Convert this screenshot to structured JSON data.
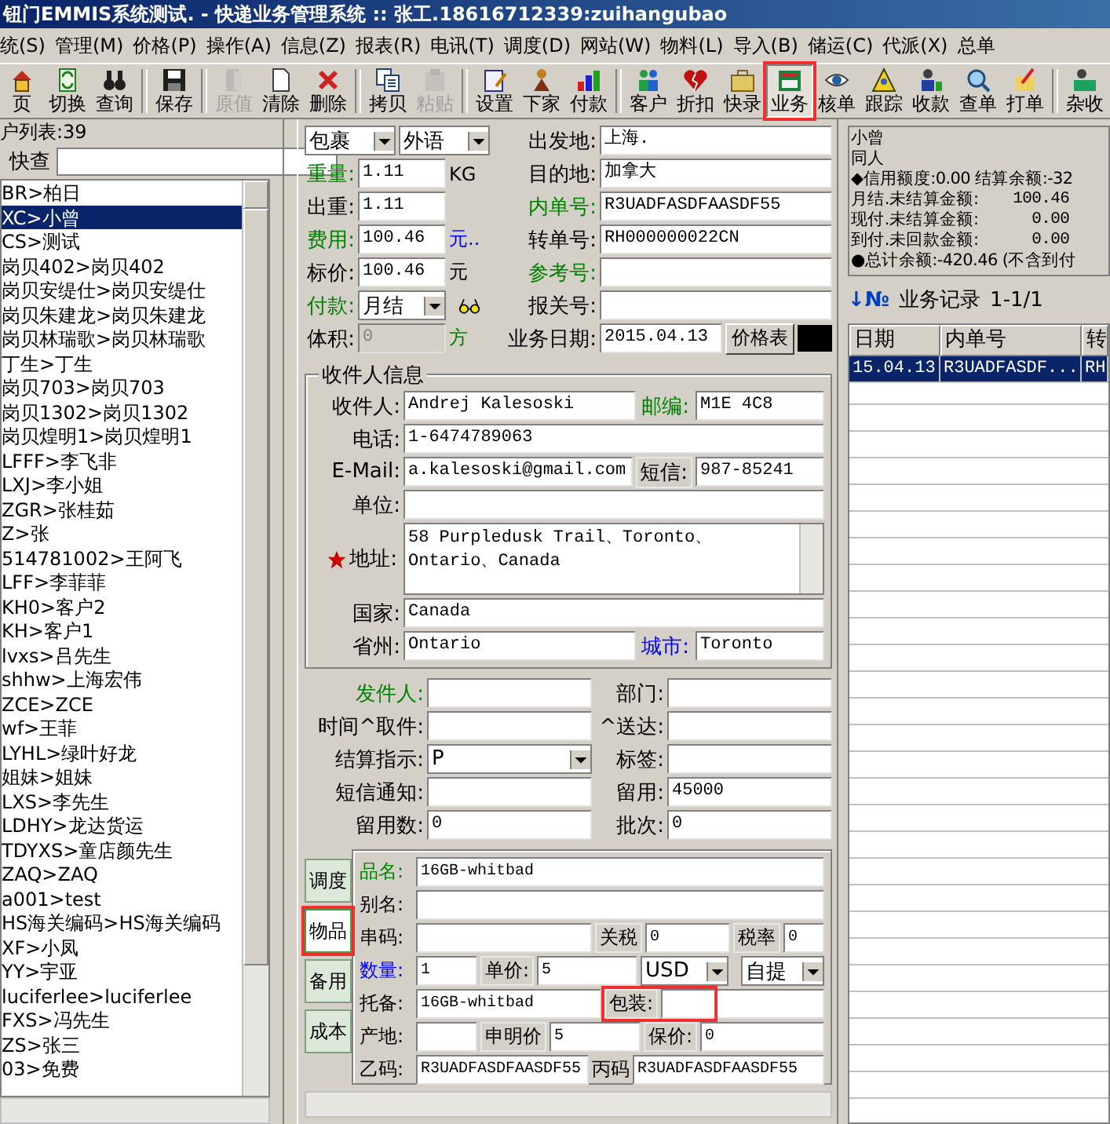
{
  "window": {
    "title": "钮门EMMIS系统测试. - 快递业务管理系统 :: 张工.18616712339:zuihangubao"
  },
  "menu": [
    "统(S)",
    "管理(M)",
    "价格(P)",
    "操作(A)",
    "信息(Z)",
    "报表(R)",
    "电讯(T)",
    "调度(D)",
    "网站(W)",
    "物料(L)",
    "导入(B)",
    "储运(C)",
    "代派(X)",
    "总单"
  ],
  "toolbar": [
    {
      "kind": "button",
      "label": "页",
      "disabled": false,
      "selected": false
    },
    {
      "kind": "button",
      "label": "切换",
      "disabled": false,
      "selected": false
    },
    {
      "kind": "button",
      "label": "查询",
      "disabled": false,
      "selected": false
    },
    {
      "kind": "separator"
    },
    {
      "kind": "button",
      "label": "保存",
      "disabled": false,
      "selected": false
    },
    {
      "kind": "separator"
    },
    {
      "kind": "button",
      "label": "原值",
      "disabled": true,
      "selected": false
    },
    {
      "kind": "button",
      "label": "清除",
      "disabled": false,
      "selected": false
    },
    {
      "kind": "button",
      "label": "删除",
      "disabled": false,
      "selected": false
    },
    {
      "kind": "separator"
    },
    {
      "kind": "button",
      "label": "拷贝",
      "disabled": false,
      "selected": false
    },
    {
      "kind": "button",
      "label": "粘贴",
      "disabled": true,
      "selected": false
    },
    {
      "kind": "separator"
    },
    {
      "kind": "button",
      "label": "设置",
      "disabled": false,
      "selected": false
    },
    {
      "kind": "button",
      "label": "下家",
      "disabled": false,
      "selected": false
    },
    {
      "kind": "button",
      "label": "付款",
      "disabled": false,
      "selected": false
    },
    {
      "kind": "separator"
    },
    {
      "kind": "button",
      "label": "客户",
      "disabled": false,
      "selected": false
    },
    {
      "kind": "button",
      "label": "折扣",
      "disabled": false,
      "selected": false
    },
    {
      "kind": "button",
      "label": "快录",
      "disabled": false,
      "selected": false
    },
    {
      "kind": "button",
      "label": "业务",
      "disabled": false,
      "selected": true
    },
    {
      "kind": "button",
      "label": "核单",
      "disabled": false,
      "selected": false
    },
    {
      "kind": "button",
      "label": "跟踪",
      "disabled": false,
      "selected": false
    },
    {
      "kind": "button",
      "label": "收款",
      "disabled": false,
      "selected": false
    },
    {
      "kind": "button",
      "label": "查单",
      "disabled": false,
      "selected": false
    },
    {
      "kind": "button",
      "label": "打单",
      "disabled": false,
      "selected": false
    },
    {
      "kind": "separator"
    },
    {
      "kind": "button",
      "label": "杂收",
      "disabled": false,
      "selected": false
    }
  ],
  "customers": {
    "title": "户列表:39",
    "search_label": "快查",
    "items": [
      {
        "text": "BR>柏日",
        "selected": false
      },
      {
        "text": "XC>小曾",
        "selected": true
      },
      {
        "text": "CS>测试",
        "selected": false
      },
      {
        "text": "岗贝402>岗贝402",
        "selected": false
      },
      {
        "text": "岗贝安缇仕>岗贝安缇仕",
        "selected": false
      },
      {
        "text": "岗贝朱建龙>岗贝朱建龙",
        "selected": false
      },
      {
        "text": "岗贝林瑞歌>岗贝林瑞歌",
        "selected": false
      },
      {
        "text": "丁生>丁生",
        "selected": false
      },
      {
        "text": "岗贝703>岗贝703",
        "selected": false
      },
      {
        "text": "岗贝1302>岗贝1302",
        "selected": false
      },
      {
        "text": "岗贝煌明1>岗贝煌明1",
        "selected": false
      },
      {
        "text": "LFFF>李飞非",
        "selected": false
      },
      {
        "text": "LXJ>李小姐",
        "selected": false
      },
      {
        "text": "ZGR>张桂茹",
        "selected": false
      },
      {
        "text": "Z>张",
        "selected": false
      },
      {
        "text": "514781002>王阿飞",
        "selected": false
      },
      {
        "text": "LFF>李菲菲",
        "selected": false
      },
      {
        "text": "KH0>客户2",
        "selected": false
      },
      {
        "text": "KH>客户1",
        "selected": false
      },
      {
        "text": "lvxs>吕先生",
        "selected": false
      },
      {
        "text": "shhw>上海宏伟",
        "selected": false
      },
      {
        "text": "ZCE>ZCE",
        "selected": false
      },
      {
        "text": "wf>王菲",
        "selected": false
      },
      {
        "text": "LYHL>绿叶好龙",
        "selected": false
      },
      {
        "text": "姐妹>姐妹",
        "selected": false
      },
      {
        "text": "LXS>李先生",
        "selected": false
      },
      {
        "text": "LDHY>龙达货运",
        "selected": false
      },
      {
        "text": "TDYXS>童店颜先生",
        "selected": false
      },
      {
        "text": "ZAQ>ZAQ",
        "selected": false
      },
      {
        "text": "a001>test",
        "selected": false
      },
      {
        "text": "HS海关编码>HS海关编码",
        "selected": false
      },
      {
        "text": "XF>小凤",
        "selected": false
      },
      {
        "text": "YY>宇亚",
        "selected": false
      },
      {
        "text": "luciferlee>luciferlee",
        "selected": false
      },
      {
        "text": "FXS>冯先生",
        "selected": false
      },
      {
        "text": "ZS>张三",
        "selected": false
      },
      {
        "text": "03>免费",
        "selected": false
      }
    ]
  },
  "shipment": {
    "left_rows": [
      [
        {
          "kind": "combo",
          "value": "包裹"
        },
        {
          "kind": "combo",
          "value": "外语"
        }
      ],
      [
        {
          "kind": "label",
          "text": "重量:",
          "color": "#008000"
        },
        {
          "kind": "field",
          "value": "1.11"
        },
        {
          "kind": "unit",
          "text": "KG",
          "color": "#000000"
        }
      ],
      [
        {
          "kind": "label",
          "text": "出重:",
          "color": "#000000"
        },
        {
          "kind": "field",
          "value": "1.11"
        }
      ],
      [
        {
          "kind": "label",
          "text": "费用:",
          "color": "#008000"
        },
        {
          "kind": "field",
          "value": "100.46"
        },
        {
          "kind": "unit",
          "text": "元..",
          "color": "#0000ff"
        }
      ],
      [
        {
          "kind": "label",
          "text": "标价:",
          "color": "#000000"
        },
        {
          "kind": "field",
          "value": "100.46"
        },
        {
          "kind": "unit",
          "text": "元",
          "color": "#000000"
        }
      ],
      [
        {
          "kind": "label",
          "text": "付款:",
          "color": "#008000"
        },
        {
          "kind": "combo",
          "value": "月结"
        },
        {
          "kind": "icon"
        }
      ],
      [
        {
          "kind": "label",
          "text": "体积:",
          "color": "#000000"
        },
        {
          "kind": "field",
          "value": "0",
          "disabled": true
        },
        {
          "kind": "unit",
          "text": "方",
          "color": "#008000"
        }
      ]
    ],
    "right_rows": [
      [
        {
          "kind": "label",
          "text": "出发地:",
          "color": "#000000"
        },
        {
          "kind": "field",
          "value": "上海."
        }
      ],
      [
        {
          "kind": "label",
          "text": "目的地:",
          "color": "#000000"
        },
        {
          "kind": "field",
          "value": "加拿大"
        }
      ],
      [
        {
          "kind": "label",
          "text": "内单号:",
          "color": "#008000"
        },
        {
          "kind": "field",
          "value": "R3UADFASDFAASDF55"
        }
      ],
      [
        {
          "kind": "label",
          "text": "转单号:",
          "color": "#000000"
        },
        {
          "kind": "field",
          "value": "RH000000022CN"
        }
      ],
      [
        {
          "kind": "label",
          "text": "参考号:",
          "color": "#008000"
        },
        {
          "kind": "field"
        }
      ],
      [
        {
          "kind": "label",
          "text": "报关号:",
          "color": "#000000"
        },
        {
          "kind": "field"
        }
      ],
      [
        {
          "kind": "label",
          "text": "业务日期:",
          "color": "#000000"
        },
        {
          "kind": "field",
          "value": "2015.04.13"
        },
        {
          "kind": "button",
          "label": "价格表"
        },
        {
          "kind": "swatch"
        }
      ]
    ]
  },
  "recipient": {
    "title": "收件人信息",
    "rows": [
      [
        {
          "kind": "label",
          "text": "收件人:",
          "color": "#000000"
        },
        {
          "kind": "field",
          "value": "Andrej Kalesoski"
        },
        {
          "kind": "label",
          "text": "邮编:",
          "color": "#008000"
        },
        {
          "kind": "field",
          "value": "M1E 4C8"
        }
      ],
      [
        {
          "kind": "label",
          "text": "电话:",
          "color": "#000000"
        },
        {
          "kind": "field",
          "value": "1-6474789063"
        }
      ],
      [
        {
          "kind": "label",
          "text": "E-Mail:",
          "color": "#000000"
        },
        {
          "kind": "field",
          "value": "a.kalesoski@gmail.com"
        },
        {
          "kind": "label",
          "text": "短信:",
          "color": "#000000",
          "boxed": true
        },
        {
          "kind": "field",
          "value": "987-85241"
        }
      ],
      [
        {
          "kind": "label",
          "text": "单位:",
          "color": "#000000"
        },
        {
          "kind": "field"
        }
      ],
      [
        {
          "kind": "label",
          "text": "地址:",
          "color": "#000000",
          "required": true
        },
        {
          "kind": "textarea",
          "value": "58 Purpledusk Trail、Toronto、Ontario、Canada"
        }
      ],
      [
        {
          "kind": "label",
          "text": "国家:",
          "color": "#000000"
        },
        {
          "kind": "field",
          "value": "Canada"
        }
      ],
      [
        {
          "kind": "label",
          "text": "省州:",
          "color": "#000000"
        },
        {
          "kind": "field",
          "value": "Ontario"
        },
        {
          "kind": "label",
          "text": "城市:",
          "color": "#0000ff"
        },
        {
          "kind": "field",
          "value": "Toronto"
        }
      ]
    ]
  },
  "sender": {
    "rows": [
      [
        {
          "kind": "label",
          "text": "发件人:",
          "color": "#008000"
        },
        {
          "kind": "field"
        },
        {
          "kind": "label",
          "text": "部门:",
          "color": "#000000"
        },
        {
          "kind": "field"
        }
      ],
      [
        {
          "kind": "label",
          "text": "时间^取件:",
          "color": "#000000"
        },
        {
          "kind": "field"
        },
        {
          "kind": "label",
          "text": "^送达:",
          "color": "#000000"
        },
        {
          "kind": "field"
        }
      ],
      [
        {
          "kind": "label",
          "text": "结算指示:",
          "color": "#000000"
        },
        {
          "kind": "combo",
          "value": "P"
        },
        {
          "kind": "label",
          "text": "标签:",
          "color": "#000000"
        },
        {
          "kind": "field"
        }
      ],
      [
        {
          "kind": "label",
          "text": "短信通知:",
          "color": "#000000"
        },
        {
          "kind": "field"
        },
        {
          "kind": "label",
          "text": "留用:",
          "color": "#000000"
        },
        {
          "kind": "field",
          "value": "45000"
        }
      ],
      [
        {
          "kind": "label",
          "text": "留用数:",
          "color": "#000000"
        },
        {
          "kind": "field",
          "value": "0"
        },
        {
          "kind": "label",
          "text": "批次:",
          "color": "#000000"
        },
        {
          "kind": "field",
          "value": "0"
        }
      ]
    ]
  },
  "goods": {
    "tabs": [
      {
        "label": "调度",
        "selected": false
      },
      {
        "label": "物品",
        "selected": true
      },
      {
        "label": "备用",
        "selected": false
      },
      {
        "label": "成本",
        "selected": false
      }
    ],
    "rows": [
      [
        {
          "kind": "label",
          "text": "品名:",
          "color": "#008000"
        },
        {
          "kind": "field",
          "value": "16GB-whitbad"
        }
      ],
      [
        {
          "kind": "label",
          "text": "别名:",
          "color": "#000000"
        },
        {
          "kind": "field"
        }
      ],
      [
        {
          "kind": "label",
          "text": "串码:",
          "color": "#000000"
        },
        {
          "kind": "field"
        },
        {
          "kind": "label",
          "text": "关税",
          "color": "#000000",
          "boxed": true
        },
        {
          "kind": "field",
          "value": "0"
        },
        {
          "kind": "label",
          "text": "税率",
          "color": "#000000",
          "boxed": true
        },
        {
          "kind": "field",
          "value": "0"
        }
      ],
      [
        {
          "kind": "label",
          "text": "数量:",
          "color": "#0000ff"
        },
        {
          "kind": "field",
          "value": "1"
        },
        {
          "kind": "label",
          "text": "单价:",
          "color": "#000000",
          "boxed": true
        },
        {
          "kind": "field",
          "value": "5"
        },
        {
          "kind": "combo",
          "value": "USD"
        },
        {
          "kind": "combo",
          "value": "自提"
        }
      ],
      [
        {
          "kind": "label",
          "text": "托备:",
          "color": "#000000"
        },
        {
          "kind": "field",
          "value": "16GB-whitbad"
        },
        {
          "kind": "label",
          "text": "包装:",
          "color": "#000000",
          "boxed": true
        },
        {
          "kind": "field"
        }
      ],
      [
        {
          "kind": "label",
          "text": "产地:",
          "color": "#000000"
        },
        {
          "kind": "field"
        },
        {
          "kind": "label",
          "text": "申明价",
          "color": "#000000",
          "boxed": true
        },
        {
          "kind": "field",
          "value": "5"
        },
        {
          "kind": "label",
          "text": "保价:",
          "color": "#000000",
          "boxed": true
        },
        {
          "kind": "field",
          "value": "0"
        }
      ],
      [
        {
          "kind": "label",
          "text": "乙码:",
          "color": "#000000"
        },
        {
          "kind": "field",
          "value": "R3UADFASDFAASDF55"
        },
        {
          "kind": "label",
          "text": "丙码",
          "color": "#000000"
        },
        {
          "kind": "field",
          "value": "R3UADFASDFAASDF55"
        }
      ]
    ]
  },
  "account": {
    "lines": [
      {
        "text": "小曾"
      },
      {
        "text": "同人"
      },
      {
        "text": "◆信用额度:0.00 结算余额:-32"
      },
      {
        "text": "月结.未结算金额:",
        "value": "100.46"
      },
      {
        "text": "现付.未结算金额:",
        "value": "0.00"
      },
      {
        "text": "到付.未回款金额:",
        "value": "0.00"
      },
      {
        "text": "●总计余额:-420.46 (不含到付"
      }
    ]
  },
  "records": {
    "marker": "↓№",
    "title": "业务记录",
    "range": "1-1/1",
    "columns": [
      "日期",
      "内单号",
      "转"
    ],
    "rows": [
      {
        "cells": [
          "15.04.13",
          "R3UADFASDF...",
          "RH"
        ],
        "selected": true
      }
    ]
  }
}
